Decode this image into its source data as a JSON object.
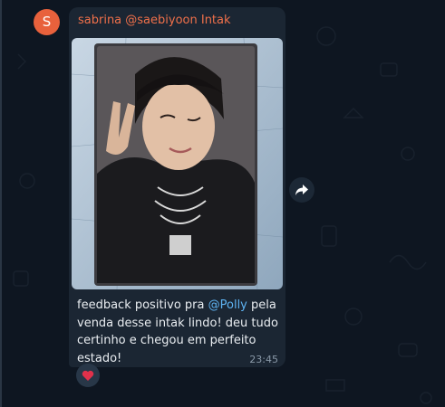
{
  "avatar": {
    "initial": "S",
    "color": "#e8613c"
  },
  "message": {
    "sender": "sabrina @saebiyoon Intak",
    "sender_color": "#f0704a",
    "text_before": "feedback positivo pra ",
    "mention": "@Polly",
    "text_after": " pela venda desse intak lindo! deu tudo certinho e chegou em perfeito estado!",
    "time": "23:45",
    "photo_subject": "photocard of a smiling young man making a peace sign"
  },
  "reaction": {
    "emoji": "heart",
    "color": "#e0314b"
  },
  "actions": {
    "forward_icon": "forward-arrow"
  },
  "theme": {
    "background": "#0e1621",
    "bubble": "#1b2633",
    "link": "#5eb3f2"
  }
}
